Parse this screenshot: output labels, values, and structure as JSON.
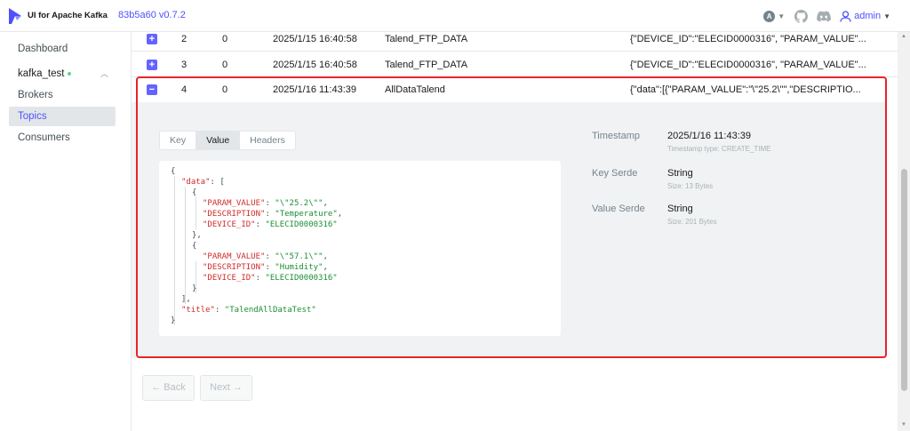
{
  "header": {
    "app_title": "UI for Apache Kafka",
    "version": "83b5a60",
    "version_tag": "v0.7.2",
    "theme_letter": "A",
    "user": "admin"
  },
  "sidebar": {
    "dashboard": "Dashboard",
    "cluster": "kafka_test",
    "items": [
      "Brokers",
      "Topics",
      "Consumers"
    ],
    "active": "Topics"
  },
  "messages": [
    {
      "offset": "2",
      "partition": "0",
      "timestamp": "2025/1/15 16:40:58",
      "key": "Talend_FTP_DATA",
      "value": "{\"DEVICE_ID\":\"ELECID0000316\", \"PARAM_VALUE\"...",
      "expanded": false
    },
    {
      "offset": "3",
      "partition": "0",
      "timestamp": "2025/1/15 16:40:58",
      "key": "Talend_FTP_DATA",
      "value": "{\"DEVICE_ID\":\"ELECID0000316\", \"PARAM_VALUE\"...",
      "expanded": false
    },
    {
      "offset": "4",
      "partition": "0",
      "timestamp": "2025/1/16 11:43:39",
      "key": "AllDataTalend",
      "value": "{\"data\":[{\"PARAM_VALUE\":\"\\\"25.2\\\"\",\"DESCRIPTIO...",
      "expanded": true
    }
  ],
  "detail": {
    "tabs": [
      "Key",
      "Value",
      "Headers"
    ],
    "active_tab": "Value",
    "json_lines": [
      {
        "indent": 0,
        "parts": [
          [
            "p",
            "{"
          ]
        ]
      },
      {
        "indent": 1,
        "parts": [
          [
            "k",
            "\"data\""
          ],
          [
            "p",
            ": ["
          ]
        ]
      },
      {
        "indent": 2,
        "parts": [
          [
            "p",
            "{"
          ]
        ]
      },
      {
        "indent": 3,
        "parts": [
          [
            "k",
            "\"PARAM_VALUE\""
          ],
          [
            "p",
            ": "
          ],
          [
            "s",
            "\"\\\"25.2\\\"\""
          ],
          [
            "p",
            ","
          ]
        ]
      },
      {
        "indent": 3,
        "parts": [
          [
            "k",
            "\"DESCRIPTION\""
          ],
          [
            "p",
            ": "
          ],
          [
            "s",
            "\"Temperature\""
          ],
          [
            "p",
            ","
          ]
        ]
      },
      {
        "indent": 3,
        "parts": [
          [
            "k",
            "\"DEVICE_ID\""
          ],
          [
            "p",
            ": "
          ],
          [
            "s",
            "\"ELECID0000316\""
          ]
        ]
      },
      {
        "indent": 2,
        "parts": [
          [
            "p",
            "},"
          ]
        ]
      },
      {
        "indent": 2,
        "parts": [
          [
            "p",
            "{"
          ]
        ]
      },
      {
        "indent": 3,
        "parts": [
          [
            "k",
            "\"PARAM_VALUE\""
          ],
          [
            "p",
            ": "
          ],
          [
            "s",
            "\"\\\"57.1\\\"\""
          ],
          [
            "p",
            ","
          ]
        ]
      },
      {
        "indent": 3,
        "parts": [
          [
            "k",
            "\"DESCRIPTION\""
          ],
          [
            "p",
            ": "
          ],
          [
            "s",
            "\"Humidity\""
          ],
          [
            "p",
            ","
          ]
        ]
      },
      {
        "indent": 3,
        "parts": [
          [
            "k",
            "\"DEVICE_ID\""
          ],
          [
            "p",
            ": "
          ],
          [
            "s",
            "\"ELECID0000316\""
          ]
        ]
      },
      {
        "indent": 2,
        "parts": [
          [
            "p",
            "}"
          ]
        ]
      },
      {
        "indent": 1,
        "parts": [
          [
            "p",
            "],"
          ]
        ]
      },
      {
        "indent": 1,
        "parts": [
          [
            "k",
            "\"title\""
          ],
          [
            "p",
            ": "
          ],
          [
            "s",
            "\"TalendAllDataTest\""
          ]
        ]
      },
      {
        "indent": 0,
        "parts": [
          [
            "p",
            "}"
          ]
        ]
      }
    ],
    "timestamp_label": "Timestamp",
    "timestamp_value": "2025/1/16 11:43:39",
    "timestamp_type": "Timestamp type: CREATE_TIME",
    "key_serde_label": "Key Serde",
    "key_serde_value": "String",
    "key_size": "Size: 13 Bytes",
    "value_serde_label": "Value Serde",
    "value_serde_value": "String",
    "value_size": "Size: 201 Bytes"
  },
  "pagination": {
    "back": "← Back",
    "next": "Next →"
  },
  "colors": {
    "accent": "#4f4fff",
    "highlight_border": "#e8242b",
    "json_key": "#d12b2b",
    "json_string": "#1a8f33"
  }
}
